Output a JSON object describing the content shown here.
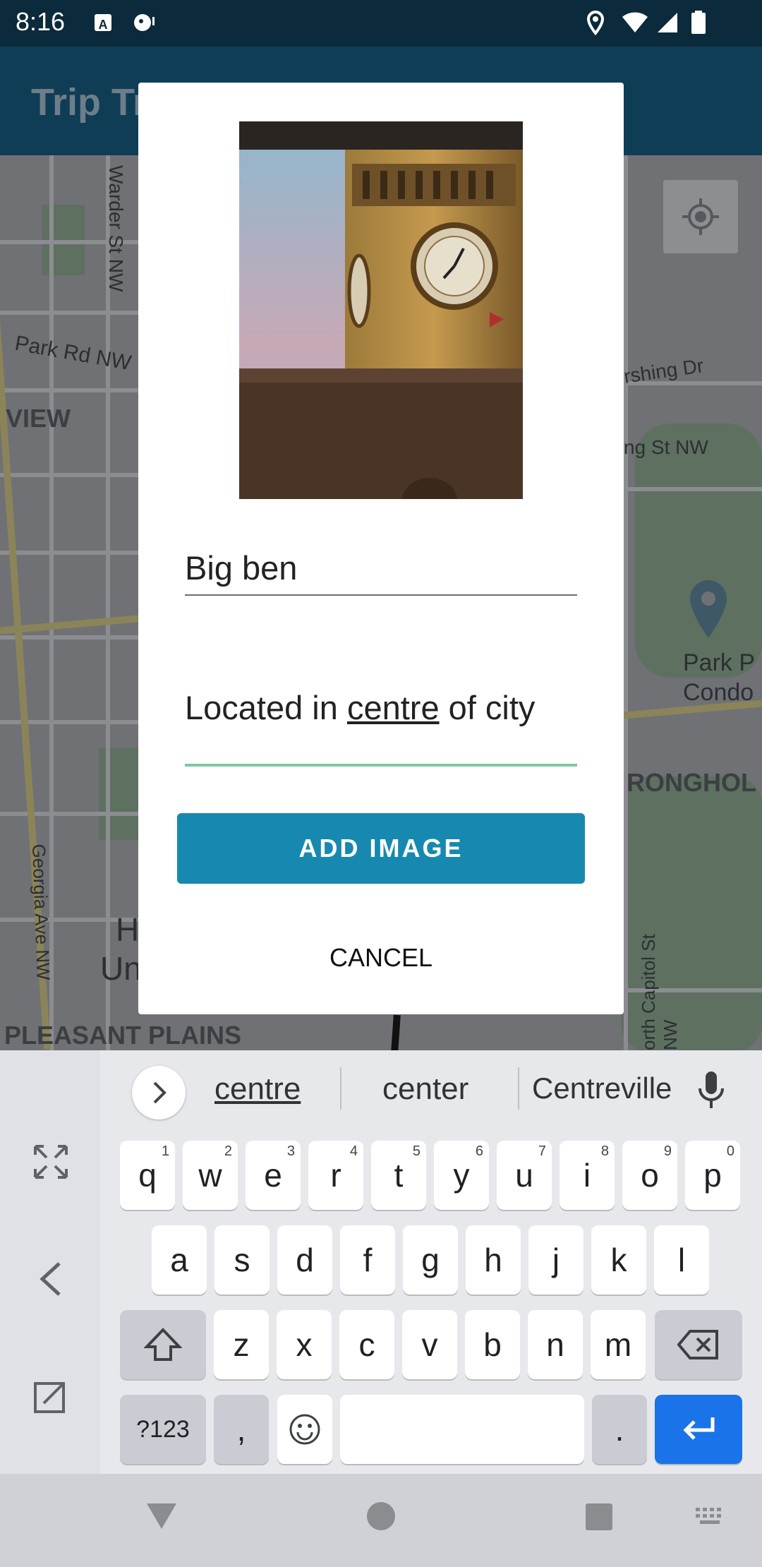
{
  "status_bar": {
    "time": "8:16"
  },
  "app_bar": {
    "title": "Trip Tr"
  },
  "map": {
    "labels": {
      "warder": "Warder St NW",
      "park_rd": "Park Rd NW",
      "view": "VIEW",
      "pershing": "rshing Dr",
      "ng_st": "ng St NW",
      "park_p": "Park P",
      "condo": "Condo",
      "stronghold": "RONGHOL",
      "georgia": "Georgia Ave NW",
      "capitol": "orth Capitol St NW",
      "pleasant": "PLEASANT PLAINS",
      "h": "H",
      "un": "Un"
    }
  },
  "dialog": {
    "name_value": "Big ben",
    "desc_prefix": "Located in ",
    "desc_word": "centre",
    "desc_suffix": " of city",
    "add_label": "ADD IMAGE",
    "cancel_label": "CANCEL"
  },
  "keyboard": {
    "suggestions": [
      "centre",
      "center",
      "Centreville"
    ],
    "row1": [
      {
        "k": "q",
        "s": "1"
      },
      {
        "k": "w",
        "s": "2"
      },
      {
        "k": "e",
        "s": "3"
      },
      {
        "k": "r",
        "s": "4"
      },
      {
        "k": "t",
        "s": "5"
      },
      {
        "k": "y",
        "s": "6"
      },
      {
        "k": "u",
        "s": "7"
      },
      {
        "k": "i",
        "s": "8"
      },
      {
        "k": "o",
        "s": "9"
      },
      {
        "k": "p",
        "s": "0"
      }
    ],
    "row2": [
      "a",
      "s",
      "d",
      "f",
      "g",
      "h",
      "j",
      "k",
      "l"
    ],
    "row3": [
      "z",
      "x",
      "c",
      "v",
      "b",
      "n",
      "m"
    ],
    "symbols_label": "?123",
    "comma": ",",
    "period": "."
  },
  "colors": {
    "accent": "#1789b0",
    "focus_line": "#7ec8a4",
    "enter_key": "#1a73e8"
  }
}
